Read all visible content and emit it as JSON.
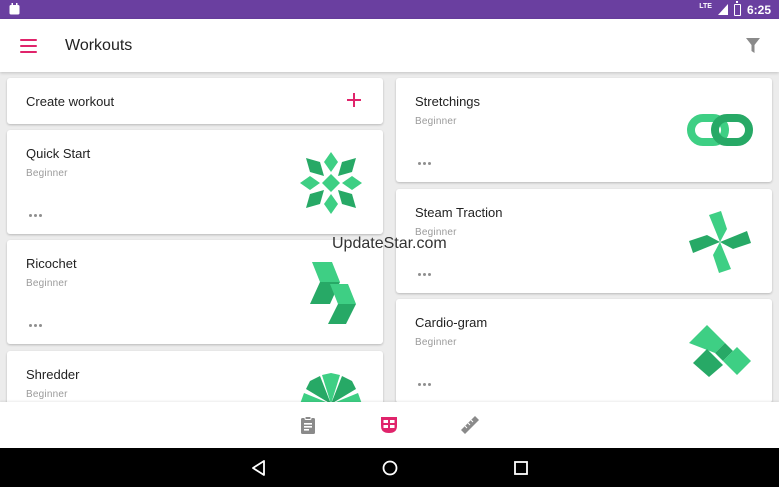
{
  "status_bar": {
    "time": "6:25",
    "network_label": "LTE",
    "icons": [
      "notification-icon",
      "lte-signal-icon",
      "battery-icon"
    ]
  },
  "app_bar": {
    "title": "Workouts",
    "menu_icon": "hamburger-menu-icon",
    "filter_icon": "filter-icon",
    "accent_color": "#e0246b"
  },
  "create_card": {
    "label": "Create workout",
    "icon": "plus-icon"
  },
  "workouts_left": [
    {
      "name": "Quick Start",
      "level": "Beginner",
      "icon": "snowflake-icon"
    },
    {
      "name": "Ricochet",
      "level": "Beginner",
      "icon": "bolt-shapes-icon"
    },
    {
      "name": "Shredder",
      "level": "Beginner",
      "icon": "burst-icon"
    }
  ],
  "workouts_right": [
    {
      "name": "Stretchings",
      "level": "Beginner",
      "icon": "chain-link-icon"
    },
    {
      "name": "Steam Traction",
      "level": "Beginner",
      "icon": "pinwheel-icon"
    },
    {
      "name": "Cardio-gram",
      "level": "Beginner",
      "icon": "zigzag-icon"
    }
  ],
  "watermark": "UpdateStar.com",
  "bottom_nav": [
    {
      "icon": "clipboard-icon",
      "active": false
    },
    {
      "icon": "workouts-grid-icon",
      "active": true
    },
    {
      "icon": "ruler-icon",
      "active": false
    }
  ],
  "system_nav": [
    "back-icon",
    "home-icon",
    "recents-icon"
  ],
  "colors": {
    "status_bar": "#6a3fa0",
    "accent": "#e0246b",
    "art_green": "#3ecf84",
    "art_green_dark": "#27a966"
  }
}
